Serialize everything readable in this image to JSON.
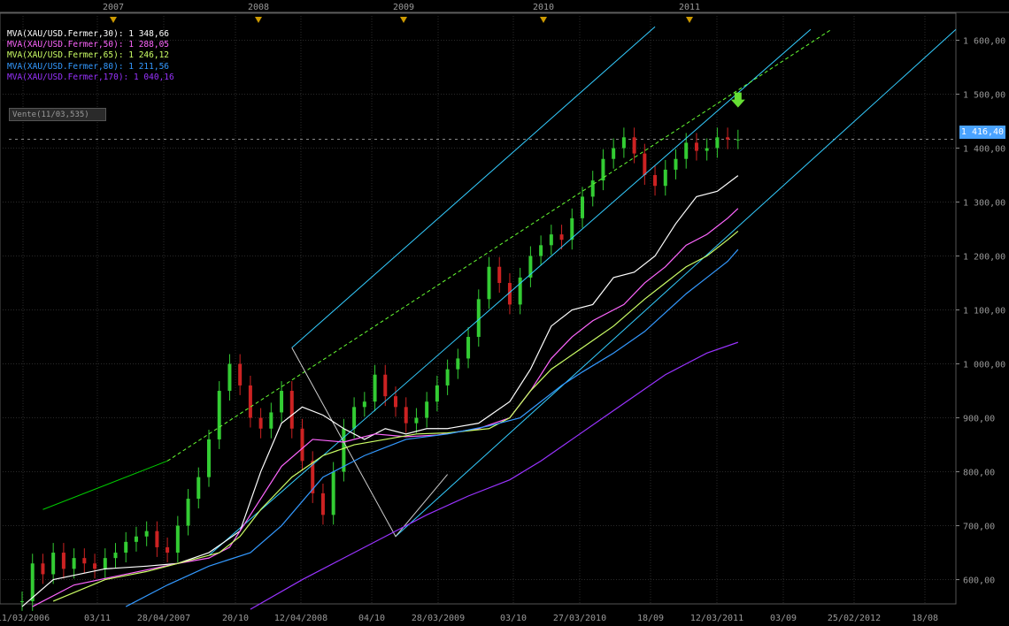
{
  "chart_data": {
    "type": "candlestick",
    "instrument": "XAU/USD",
    "year_markers": [
      "2007",
      "2008",
      "2009",
      "2010",
      "2011"
    ],
    "x_tick_labels": [
      "11/03/2006",
      "03/11",
      "28/04/2007",
      "20/10",
      "12/04/2008",
      "04/10",
      "28/03/2009",
      "03/10",
      "27/03/2010",
      "18/09",
      "12/03/2011",
      "03/09",
      "25/02/2012",
      "18/08"
    ],
    "y_tick_labels": [
      "600,00",
      "700,00",
      "800,00",
      "900,00",
      "1 000,00",
      "1 100,00",
      "1 200,00",
      "1 300,00",
      "1 400,00",
      "1 500,00",
      "1 600,00"
    ],
    "ylim": [
      555,
      1650
    ],
    "grid": true,
    "current_price_label": "1 416,40",
    "current_price": 1416.4,
    "vente_label": "Vente(11/03,535)",
    "legend": [
      {
        "label": "MVA(XAU/USD.Fermer,30): 1 348,66",
        "color": "#ffffff"
      },
      {
        "label": "MVA(XAU/USD.Fermer,50): 1 288,05",
        "color": "#ff66ff"
      },
      {
        "label": "MVA(XAU/USD.Fermer,65): 1 246,12",
        "color": "#ccff66"
      },
      {
        "label": "MVA(XAU/USD.Fermer,80): 1 211,56",
        "color": "#3399ff"
      },
      {
        "label": "MVA(XAU/USD.Fermer,170): 1 040,16",
        "color": "#9933ff"
      }
    ],
    "series": [
      {
        "name": "MVA 30",
        "color": "#ffffff",
        "points": [
          [
            0,
            550
          ],
          [
            3,
            600
          ],
          [
            8,
            620
          ],
          [
            12,
            625
          ],
          [
            15,
            630
          ],
          [
            18,
            650
          ],
          [
            21,
            690
          ],
          [
            23,
            800
          ],
          [
            25,
            890
          ],
          [
            27,
            920
          ],
          [
            29,
            905
          ],
          [
            31,
            880
          ],
          [
            33,
            860
          ],
          [
            35,
            880
          ],
          [
            37,
            870
          ],
          [
            39,
            880
          ],
          [
            41,
            880
          ],
          [
            44,
            890
          ],
          [
            47,
            930
          ],
          [
            49,
            990
          ],
          [
            51,
            1070
          ],
          [
            53,
            1100
          ],
          [
            55,
            1110
          ],
          [
            57,
            1160
          ],
          [
            59,
            1170
          ],
          [
            61,
            1200
          ],
          [
            63,
            1260
          ],
          [
            65,
            1310
          ],
          [
            67,
            1320
          ],
          [
            69,
            1349
          ]
        ]
      },
      {
        "name": "MVA 50",
        "color": "#ff66ff",
        "points": [
          [
            1,
            550
          ],
          [
            5,
            590
          ],
          [
            10,
            610
          ],
          [
            15,
            630
          ],
          [
            18,
            640
          ],
          [
            20,
            660
          ],
          [
            22,
            720
          ],
          [
            25,
            810
          ],
          [
            28,
            860
          ],
          [
            31,
            855
          ],
          [
            34,
            870
          ],
          [
            37,
            865
          ],
          [
            40,
            868
          ],
          [
            44,
            880
          ],
          [
            47,
            900
          ],
          [
            49,
            950
          ],
          [
            51,
            1010
          ],
          [
            53,
            1050
          ],
          [
            55,
            1080
          ],
          [
            58,
            1110
          ],
          [
            60,
            1150
          ],
          [
            62,
            1180
          ],
          [
            64,
            1220
          ],
          [
            66,
            1240
          ],
          [
            68,
            1270
          ],
          [
            69,
            1288
          ]
        ]
      },
      {
        "name": "MVA 65",
        "color": "#ccff66",
        "points": [
          [
            3,
            560
          ],
          [
            8,
            600
          ],
          [
            12,
            615
          ],
          [
            16,
            635
          ],
          [
            19,
            650
          ],
          [
            21,
            680
          ],
          [
            23,
            730
          ],
          [
            26,
            790
          ],
          [
            29,
            830
          ],
          [
            32,
            850
          ],
          [
            35,
            860
          ],
          [
            38,
            870
          ],
          [
            41,
            872
          ],
          [
            45,
            880
          ],
          [
            47,
            900
          ],
          [
            49,
            950
          ],
          [
            51,
            990
          ],
          [
            54,
            1030
          ],
          [
            57,
            1070
          ],
          [
            60,
            1120
          ],
          [
            62,
            1150
          ],
          [
            64,
            1180
          ],
          [
            66,
            1200
          ],
          [
            68,
            1230
          ],
          [
            69,
            1246
          ]
        ]
      },
      {
        "name": "MVA 80",
        "color": "#3399ff",
        "points": [
          [
            10,
            550
          ],
          [
            14,
            590
          ],
          [
            18,
            625
          ],
          [
            22,
            650
          ],
          [
            25,
            700
          ],
          [
            29,
            790
          ],
          [
            33,
            830
          ],
          [
            37,
            860
          ],
          [
            41,
            870
          ],
          [
            45,
            885
          ],
          [
            48,
            900
          ],
          [
            50,
            930
          ],
          [
            52,
            960
          ],
          [
            54,
            985
          ],
          [
            57,
            1020
          ],
          [
            60,
            1060
          ],
          [
            62,
            1095
          ],
          [
            64,
            1130
          ],
          [
            66,
            1160
          ],
          [
            68,
            1190
          ],
          [
            69,
            1212
          ]
        ]
      },
      {
        "name": "MVA 170",
        "color": "#9933ff",
        "points": [
          [
            22,
            545
          ],
          [
            27,
            600
          ],
          [
            31,
            640
          ],
          [
            35,
            680
          ],
          [
            39,
            720
          ],
          [
            43,
            755
          ],
          [
            47,
            785
          ],
          [
            50,
            820
          ],
          [
            53,
            860
          ],
          [
            56,
            900
          ],
          [
            59,
            940
          ],
          [
            62,
            980
          ],
          [
            64,
            1000
          ],
          [
            66,
            1020
          ],
          [
            69,
            1040
          ]
        ]
      }
    ],
    "trend_lines": [
      {
        "name": "upper channel",
        "color": "#33ccff",
        "from": [
          26,
          1030
        ],
        "to": [
          61,
          1625
        ]
      },
      {
        "name": "middle channel",
        "color": "#33ccff",
        "from": [
          18,
          645
        ],
        "to": [
          76,
          1620
        ]
      },
      {
        "name": "lower channel",
        "color": "#33ccff",
        "from": [
          36,
          680
        ],
        "to": [
          90,
          1620
        ]
      },
      {
        "name": "support line",
        "color": "#00cc00",
        "from": [
          2,
          730
        ],
        "to": [
          14,
          820
        ]
      },
      {
        "name": "resistance dashed",
        "color": "#66ff33",
        "from": [
          14,
          820
        ],
        "to": [
          78,
          1620
        ],
        "dashed": true
      },
      {
        "name": "zigzag",
        "color": "#cccccc",
        "polyline": [
          [
            26,
            1030
          ],
          [
            36,
            680
          ],
          [
            41,
            795
          ]
        ]
      }
    ],
    "candles_close": [
      560,
      630,
      610,
      650,
      620,
      640,
      630,
      620,
      640,
      650,
      670,
      680,
      690,
      660,
      650,
      700,
      750,
      790,
      860,
      950,
      1000,
      960,
      900,
      880,
      910,
      950,
      880,
      820,
      760,
      720,
      800,
      880,
      920,
      930,
      980,
      940,
      920,
      890,
      900,
      930,
      960,
      990,
      1010,
      1050,
      1120,
      1180,
      1150,
      1110,
      1160,
      1200,
      1220,
      1240,
      1230,
      1270,
      1310,
      1340,
      1380,
      1400,
      1420,
      1390,
      1350,
      1330,
      1360,
      1380,
      1410,
      1395,
      1400,
      1420,
      1416,
      1416
    ],
    "last_candle_arrow": "down-arrow-icon"
  }
}
